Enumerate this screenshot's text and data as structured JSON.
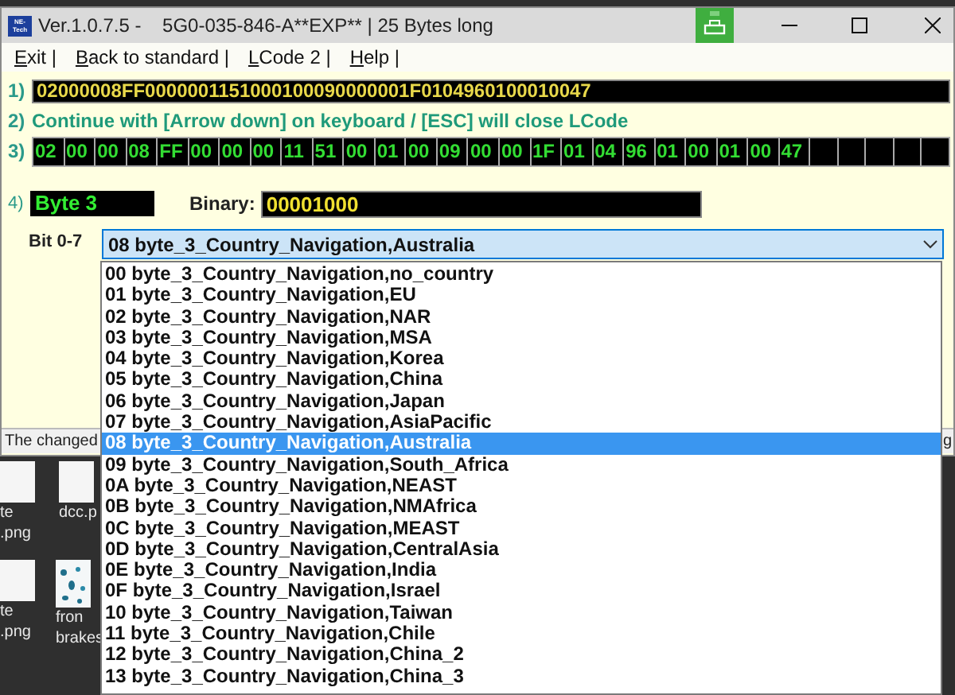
{
  "window": {
    "app_icon_text": "NE-Tech",
    "title": "Ver.1.0.7.5 -    5G0-035-846-A**EXP** | 25 Bytes long"
  },
  "menu": [
    {
      "label": "Exit |"
    },
    {
      "label": "Back to standard |"
    },
    {
      "label": "LCode 2 |"
    },
    {
      "label": "Help |"
    }
  ],
  "code_row": {
    "label": "1)",
    "value": "02000008FF0000001151000100090000001F0104960100010047"
  },
  "hint_row": {
    "label": "2)",
    "text": "Continue with [Arrow down] on keyboard / [ESC] will close LCode"
  },
  "bytes_row": {
    "label": "3)",
    "bytes": [
      "02",
      "00",
      "00",
      "08",
      "FF",
      "00",
      "00",
      "00",
      "11",
      "51",
      "00",
      "01",
      "00",
      "09",
      "00",
      "00",
      "1F",
      "01",
      "04",
      "96",
      "01",
      "00",
      "01",
      "00",
      "47"
    ]
  },
  "byte_row": {
    "label": "4)",
    "byte_name": "Byte 3",
    "binary_label": "Binary:",
    "binary": "00001000"
  },
  "bit_select": {
    "label": "Bit 0-7",
    "value": "08 byte_3_Country_Navigation,Australia",
    "expanded": true,
    "options": [
      {
        "text": "00 byte_3_Country_Navigation,no_country",
        "selected": false
      },
      {
        "text": "01 byte_3_Country_Navigation,EU",
        "selected": false
      },
      {
        "text": "02 byte_3_Country_Navigation,NAR",
        "selected": false
      },
      {
        "text": "03 byte_3_Country_Navigation,MSA",
        "selected": false
      },
      {
        "text": "04 byte_3_Country_Navigation,Korea",
        "selected": false
      },
      {
        "text": "05 byte_3_Country_Navigation,China",
        "selected": false
      },
      {
        "text": "06 byte_3_Country_Navigation,Japan",
        "selected": false
      },
      {
        "text": "07 byte_3_Country_Navigation,AsiaPacific",
        "selected": false
      },
      {
        "text": "08 byte_3_Country_Navigation,Australia",
        "selected": true
      },
      {
        "text": "09 byte_3_Country_Navigation,South_Africa",
        "selected": false
      },
      {
        "text": "0A byte_3_Country_Navigation,NEAST",
        "selected": false
      },
      {
        "text": "0B byte_3_Country_Navigation,NMAfrica",
        "selected": false
      },
      {
        "text": "0C byte_3_Country_Navigation,MEAST",
        "selected": false
      },
      {
        "text": "0D byte_3_Country_Navigation,CentralAsia",
        "selected": false
      },
      {
        "text": "0E byte_3_Country_Navigation,India",
        "selected": false
      },
      {
        "text": "0F byte_3_Country_Navigation,Israel",
        "selected": false
      },
      {
        "text": "10 byte_3_Country_Navigation,Taiwan",
        "selected": false
      },
      {
        "text": "11 byte_3_Country_Navigation,Chile",
        "selected": false
      },
      {
        "text": "12 byte_3_Country_Navigation,China_2",
        "selected": false
      },
      {
        "text": "13 byte_3_Country_Navigation,China_3",
        "selected": false
      }
    ]
  },
  "status_bar": {
    "text": "The changed",
    "tail": "g"
  },
  "desktop_icons": [
    {
      "kind": "file",
      "lines": [
        "te",
        ".png"
      ]
    },
    {
      "kind": "file",
      "lines": [
        "dcc.p"
      ]
    },
    {
      "kind": "file",
      "lines": [
        "te",
        ".png"
      ]
    },
    {
      "kind": "picture",
      "lines": [
        "fron",
        "brakes"
      ]
    }
  ]
}
